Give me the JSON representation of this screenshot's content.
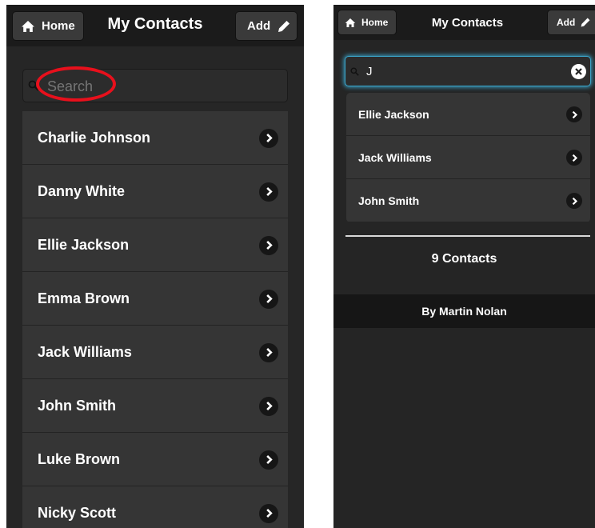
{
  "left_screen": {
    "header": {
      "home_label": "Home",
      "title": "My Contacts",
      "add_label": "Add",
      "home_icon": "home-icon",
      "add_icon": "pencil-icon"
    },
    "search": {
      "placeholder": "Search",
      "value": ""
    },
    "contacts": [
      {
        "name": "Charlie Johnson"
      },
      {
        "name": "Danny White"
      },
      {
        "name": "Ellie Jackson"
      },
      {
        "name": "Emma Brown"
      },
      {
        "name": "Jack Williams"
      },
      {
        "name": "John Smith"
      },
      {
        "name": "Luke Brown"
      },
      {
        "name": "Nicky Scott"
      }
    ]
  },
  "right_screen": {
    "header": {
      "home_label": "Home",
      "title": "My Contacts",
      "add_label": "Add",
      "home_icon": "home-icon",
      "add_icon": "pencil-icon"
    },
    "search": {
      "value": "J",
      "clear_icon": "clear-icon"
    },
    "results": [
      {
        "name": "Ellie Jackson"
      },
      {
        "name": "Jack Williams"
      },
      {
        "name": "John Smith"
      }
    ],
    "count_label": "9 Contacts",
    "footer_label": "By Martin Nolan"
  },
  "colors": {
    "annotation": "#e8101c",
    "focus_glow": "#3aa3c8",
    "background": "#262626",
    "row": "#353535"
  }
}
